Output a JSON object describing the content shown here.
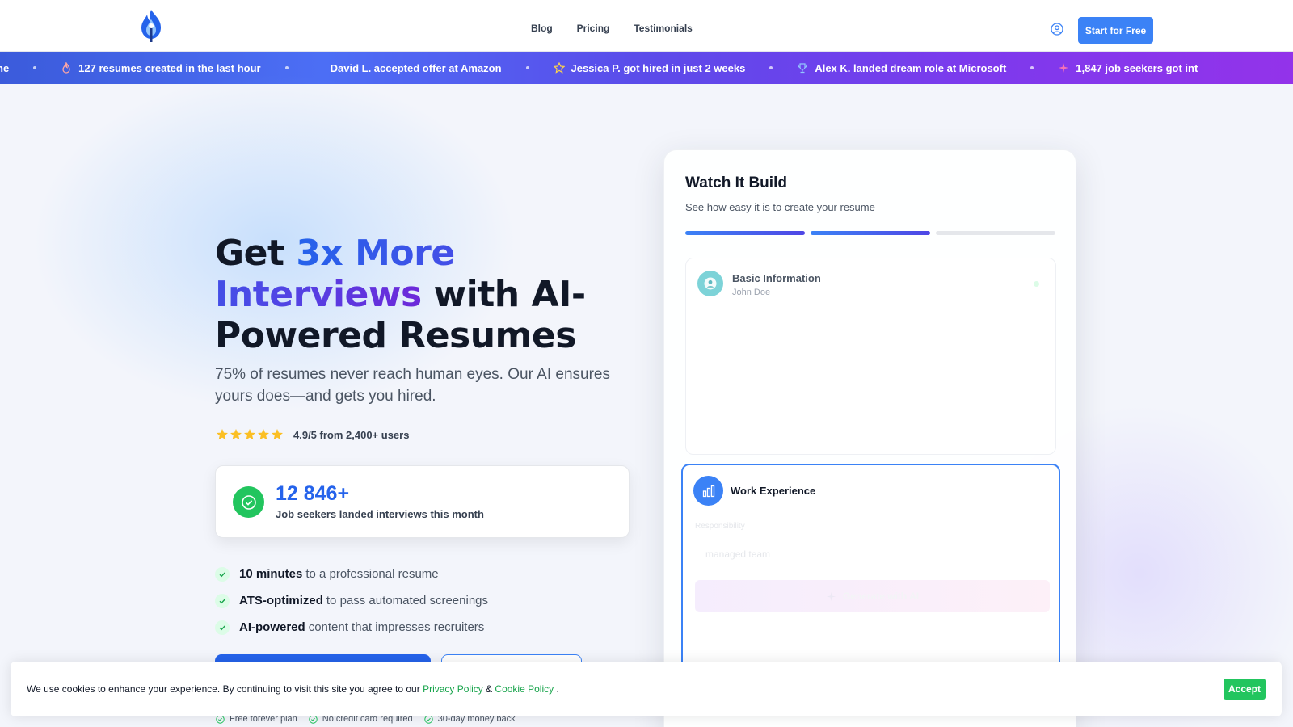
{
  "header": {
    "nav": [
      "Blog",
      "Pricing",
      "Testimonials"
    ],
    "cta_label": "Start for Free"
  },
  "ticker": {
    "items": [
      {
        "text": "ne",
        "icon": "none"
      },
      {
        "text": "127 resumes created in the last hour",
        "icon": "flame-icon"
      },
      {
        "text": "David L. accepted offer at Amazon",
        "icon": "none"
      },
      {
        "text": "Jessica P. got hired in just 2 weeks",
        "icon": "star-icon"
      },
      {
        "text": "Alex K. landed dream role at Microsoft",
        "icon": "trophy-icon"
      },
      {
        "text": "1,847 job seekers got int",
        "icon": "sparkle-icon"
      }
    ]
  },
  "hero": {
    "headline_1": "Get ",
    "headline_highlight": "3x More Interviews",
    "headline_2": " with AI-Powered Resumes",
    "subtitle": "75% of resumes never reach human eyes. Our AI ensures yours does—and gets you hired.",
    "rating": "4.9/5 from 2,400+ users",
    "stat_number": "12 846+",
    "stat_desc": "Job seekers landed interviews this month",
    "features": [
      {
        "bold": "10 minutes",
        "rest": "to a professional resume"
      },
      {
        "bold": "ATS-optimized",
        "rest": "to pass automated screenings"
      },
      {
        "bold": "AI-powered",
        "rest": "content that impresses recruiters"
      }
    ],
    "trust": [
      "Free forever plan",
      "No credit card required",
      "30-day money back"
    ]
  },
  "build_card": {
    "title": "Watch It Build",
    "subtitle": "See how easy it is to create your resume",
    "progress_completed": 2,
    "progress_total": 3,
    "step1": {
      "title": "Basic Information",
      "value": "John Doe"
    },
    "step2": {
      "title": "Work Experience",
      "field_label": "Responsibility",
      "field_value": "managed team",
      "button": "Generate with AI"
    }
  },
  "cookie": {
    "text_before": "We use cookies to enhance your experience. By continuing to visit this site you agree to our ",
    "privacy": "Privacy Policy",
    "amp": " & ",
    "cookie_policy": "Cookie Policy",
    "text_after": " .",
    "accept": "Accept"
  },
  "colors": {
    "primary": "#2563eb",
    "accent_green": "#22c55e",
    "star": "#fbbf24"
  }
}
